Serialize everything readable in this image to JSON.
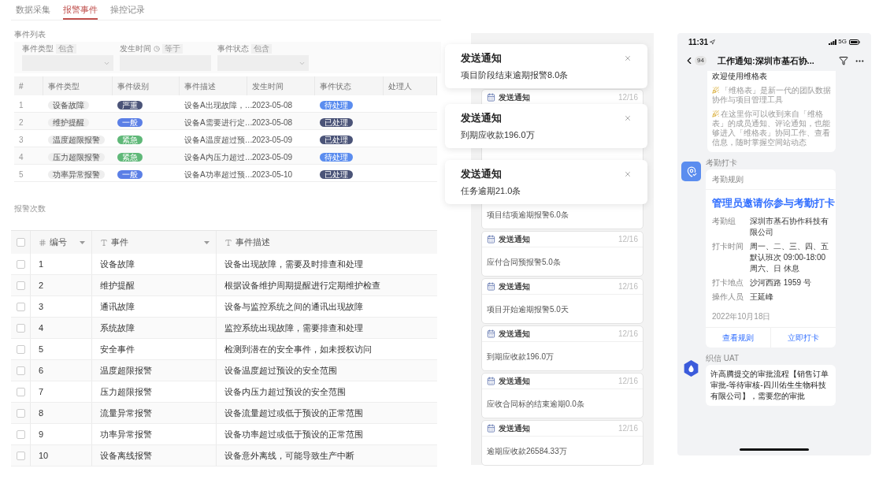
{
  "tabs": [
    {
      "label": "数据采集",
      "selected": false
    },
    {
      "label": "报警事件",
      "selected": true
    },
    {
      "label": "操控记录",
      "selected": false
    }
  ],
  "event_list": {
    "title": "事件列表",
    "filters": [
      {
        "label": "事件类型",
        "operator": "包含",
        "info_icon": false,
        "kind": "select"
      },
      {
        "label": "发生时间",
        "operator": "等于",
        "info_icon": true,
        "kind": "date"
      },
      {
        "label": "事件状态",
        "operator": "包含",
        "info_icon": false,
        "kind": "select"
      }
    ],
    "columns": [
      "#",
      "事件类型",
      "事件级别",
      "事件描述",
      "发生时间",
      "事件状态",
      "处理人"
    ],
    "rows": [
      {
        "index": "1",
        "type": "设备故障",
        "level": {
          "label": "严重",
          "color": "#4b5478"
        },
        "description": "设备A出现故障，…",
        "time": "2023-05-08",
        "status": {
          "label": "待处理",
          "color": "#5b8def"
        }
      },
      {
        "index": "2",
        "type": "维护提醒",
        "level": {
          "label": "一般",
          "color": "#5b7fe6"
        },
        "description": "设备A需要进行定…",
        "time": "2023-05-08",
        "status": {
          "label": "已处理",
          "color": "#4b5478"
        }
      },
      {
        "index": "3",
        "type": "温度超限报警",
        "level": {
          "label": "紧急",
          "color": "#5fb878"
        },
        "description": "设备A温度超过预…",
        "time": "2023-05-09",
        "status": {
          "label": "已处理",
          "color": "#4b5478"
        }
      },
      {
        "index": "4",
        "type": "压力超限报警",
        "level": {
          "label": "紧急",
          "color": "#5fb878"
        },
        "description": "设备A内压力超过…",
        "time": "2023-05-09",
        "status": {
          "label": "待处理",
          "color": "#5b8def"
        }
      },
      {
        "index": "5",
        "type": "功率异常报警",
        "level": {
          "label": "一般",
          "color": "#5b7fe6"
        },
        "description": "设备A功率超过预…",
        "time": "2023-05-10",
        "status": {
          "label": "已处理",
          "color": "#4b5478"
        }
      }
    ]
  },
  "alarm_table": {
    "title": "报警次数",
    "select_all_checked": false,
    "columns": [
      {
        "label": "编号",
        "kind": "number",
        "dropdown": true
      },
      {
        "label": "事件",
        "kind": "text",
        "dropdown": true
      },
      {
        "label": "事件描述",
        "kind": "text",
        "dropdown": false
      }
    ],
    "rows": [
      {
        "checked": false,
        "cells": [
          "1",
          "设备故障",
          "设备出现故障，需要及时排查和处理"
        ]
      },
      {
        "checked": false,
        "cells": [
          "2",
          "维护提醒",
          "根据设备维护周期提醒进行定期维护检查"
        ]
      },
      {
        "checked": false,
        "cells": [
          "3",
          "通讯故障",
          "设备与监控系统之间的通讯出现故障"
        ]
      },
      {
        "checked": false,
        "cells": [
          "4",
          "系统故障",
          "监控系统出现故障，需要排查和处理"
        ]
      },
      {
        "checked": false,
        "cells": [
          "5",
          "安全事件",
          "检测到潜在的安全事件，如未授权访问"
        ]
      },
      {
        "checked": false,
        "cells": [
          "6",
          "温度超限报警",
          "设备温度超过预设的安全范围"
        ]
      },
      {
        "checked": false,
        "cells": [
          "7",
          "压力超限报警",
          "设备内压力超过预设的安全范围"
        ]
      },
      {
        "checked": false,
        "cells": [
          "8",
          "流量异常报警",
          "设备流量超过或低于预设的正常范围"
        ]
      },
      {
        "checked": false,
        "cells": [
          "9",
          "功率异常报警",
          "设备功率超过或低于预设的正常范围"
        ]
      },
      {
        "checked": false,
        "cells": [
          "10",
          "设备离线报警",
          "设备意外离线，可能导致生产中断"
        ]
      }
    ]
  },
  "notification_cards": [
    {
      "title": "发送通知",
      "date": "12/16",
      "tall": true
    },
    {
      "body": "项目结项逾期报警6.0条"
    },
    {
      "title": "发送通知",
      "date": "12/16",
      "body": "应付合同预报警5.0条"
    },
    {
      "title": "发送通知",
      "date": "12/16",
      "body": "项目开始逾期报警5.0天"
    },
    {
      "title": "发送通知",
      "date": "12/16",
      "body": "到期应收款196.0万"
    },
    {
      "title": "发送通知",
      "date": "12/16",
      "body": "应收合同标的结束逾期0.0条"
    },
    {
      "title": "发送通知",
      "date": "12/16",
      "body": "逾期应收款26584.33万"
    }
  ],
  "toasts": [
    {
      "title": "发送通知",
      "message": "项目阶段结束逾期报警8.0条"
    },
    {
      "title": "发送通知",
      "message": "到期应收款196.0万"
    },
    {
      "title": "发送通知",
      "message": "任务逾期21.0条"
    }
  ],
  "phone": {
    "time": "11:31",
    "network": "5G",
    "nav": {
      "badge": "94",
      "title": "工作通知:深圳市基石协..."
    },
    "welcome": {
      "title": "欢迎使用维格表",
      "paragraphs": [
        "「维格表」是新一代的团队数据协作与项目管理工具",
        "在这里你可以收到来自「维格表」的成员通知、评论通知，也能够进入「维格表」协同工作、查看信息，随时掌握空间站动态"
      ]
    },
    "attendance": {
      "sender": "考勤打卡",
      "header": "考勤规则",
      "headline": "管理员邀请你参与考勤打卡",
      "fields": [
        {
          "label": "考勤组",
          "lines": [
            "深圳市基石协作科技有限公司"
          ]
        },
        {
          "label": "打卡时间",
          "lines": [
            "周一、二、三、四、五",
            "默认班次 09:00-18:00",
            "周六、日 休息"
          ]
        },
        {
          "label": "打卡地点",
          "lines": [
            "沙河西路 1959 号"
          ]
        },
        {
          "label": "操作人员",
          "lines": [
            "王延峰"
          ]
        }
      ],
      "date": "2022年10月18日",
      "actions": [
        "查看规则",
        "立即打卡"
      ]
    },
    "message": {
      "sender": "织信 UAT",
      "text": "许高腾提交的审批流程【销售订单审批-等待审核-四川佑生生物科技有限公司】，需要您的审批"
    }
  }
}
